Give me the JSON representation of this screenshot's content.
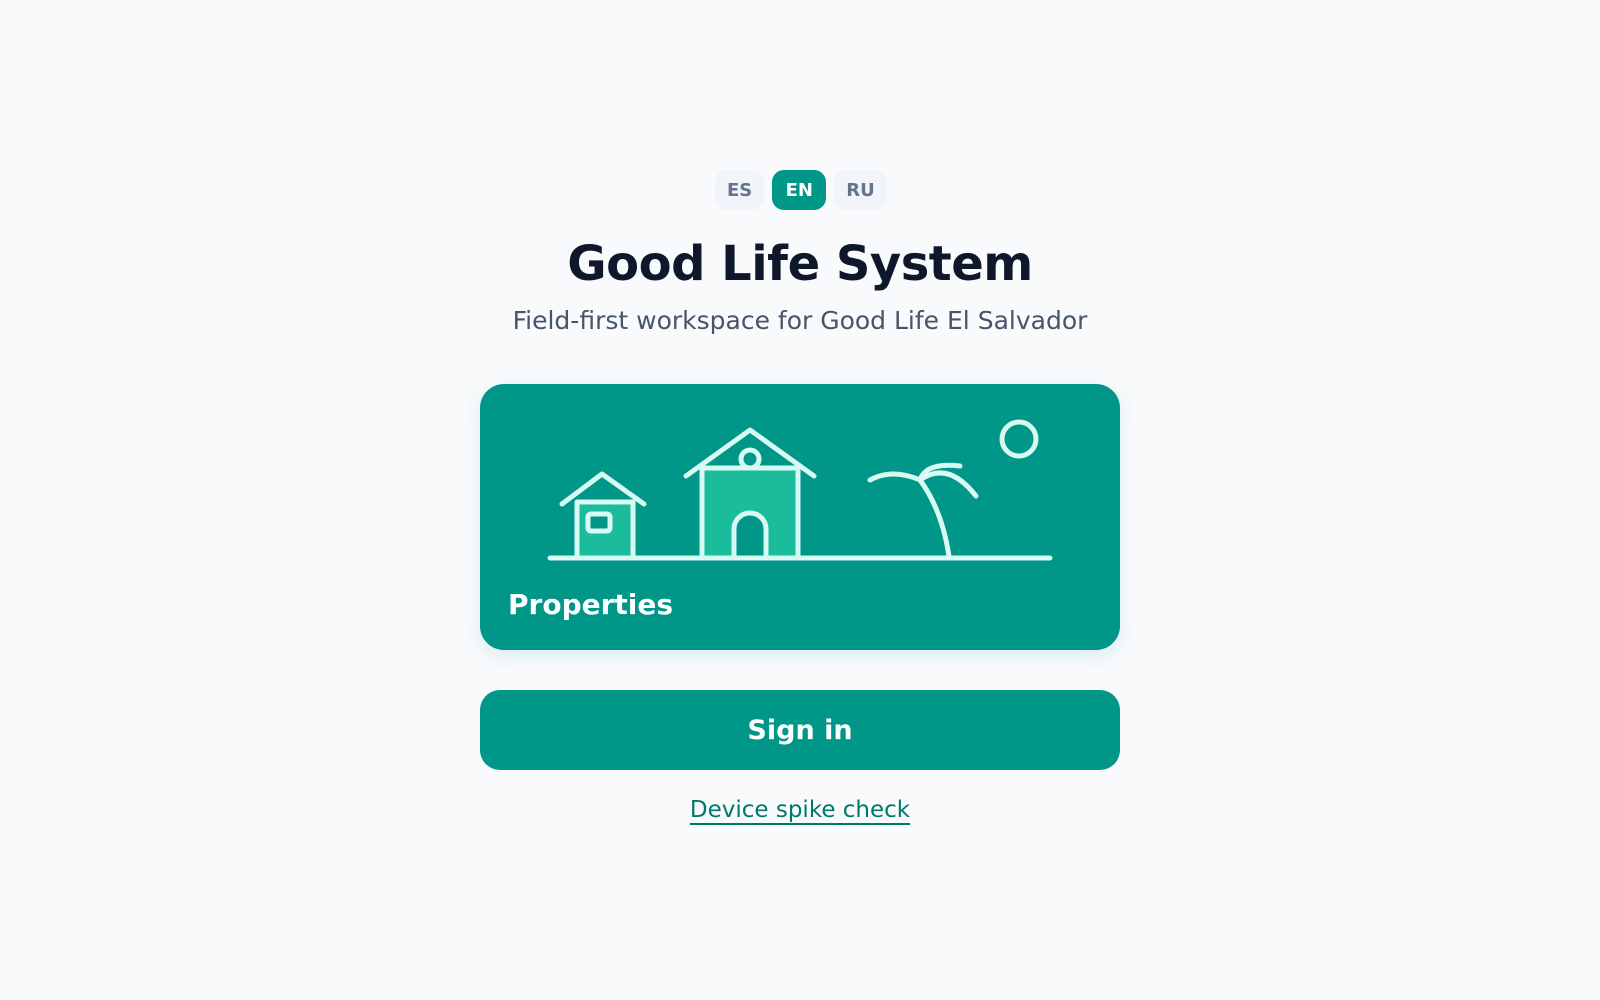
{
  "languages": {
    "es": "ES",
    "en": "EN",
    "ru": "RU",
    "active": "EN"
  },
  "header": {
    "title": "Good Life System",
    "subtitle": "Field-first workspace for Good Life El Salvador"
  },
  "hero": {
    "label": "Properties",
    "illustration_icons": [
      "small-house-icon",
      "large-house-icon",
      "palm-tree-icon",
      "sun-icon"
    ]
  },
  "actions": {
    "sign_in_label": "Sign in",
    "device_check_label": "Device spike check"
  },
  "colors": {
    "accent": "#009688",
    "accent_light": "#1abc9c",
    "line_light": "#d7faf3",
    "background": "#f8fafc",
    "title": "#0f172a",
    "subtitle": "#475569"
  }
}
